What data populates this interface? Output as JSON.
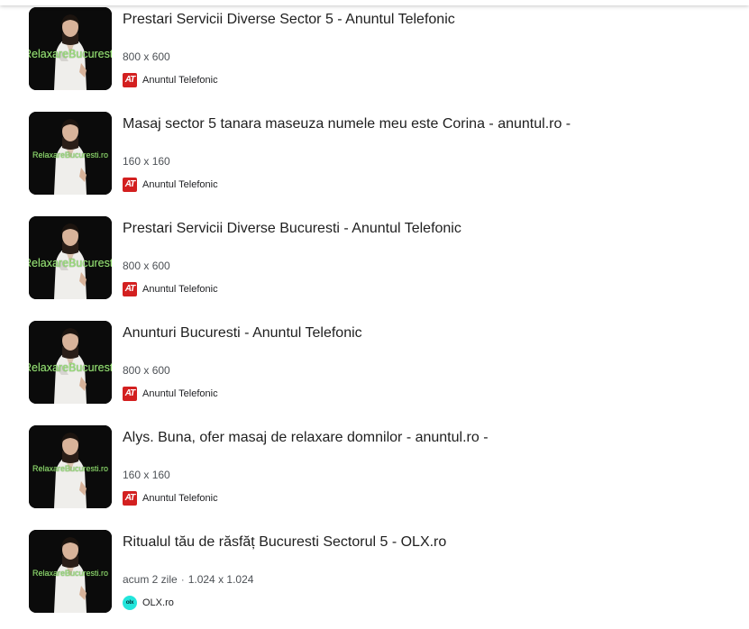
{
  "results": [
    {
      "title": "Prestari Servicii Diverse Sector 5 - Anuntul Telefonic",
      "meta": "800 x 600",
      "source": "Anuntul Telefonic",
      "favicon": "AT",
      "watermark": "RelaxareBucuresti.ro"
    },
    {
      "title": "Masaj sector 5 tanara maseuza numele meu este Corina - anuntul.ro -",
      "meta": "160 x 160",
      "source": "Anuntul Telefonic",
      "favicon": "AT",
      "watermark": "RelaxareBucuresti.ro"
    },
    {
      "title": "Prestari Servicii Diverse Bucuresti - Anuntul Telefonic",
      "meta": "800 x 600",
      "source": "Anuntul Telefonic",
      "favicon": "AT",
      "watermark": "RelaxareBucuresti.ro"
    },
    {
      "title": "Anunturi Bucuresti - Anuntul Telefonic",
      "meta": "800 x 600",
      "source": "Anuntul Telefonic",
      "favicon": "AT",
      "watermark": "RelaxareBucuresti.ro"
    },
    {
      "title": "Alys. Buna, ofer masaj de relaxare domnilor - anuntul.ro -",
      "meta": "160 x 160",
      "source": "Anuntul Telefonic",
      "favicon": "AT",
      "watermark": "RelaxareBucuresti.ro"
    },
    {
      "title": "Ritualul tău de răsfăț Bucuresti Sectorul 5 - OLX.ro",
      "meta_age": "acum 2 zile",
      "meta": "1.024 x 1.024",
      "source": "OLX.ro",
      "favicon": "olx",
      "watermark": "RelaxareBucuresti.ro"
    }
  ],
  "colors": {
    "at_favicon": "#d32020",
    "olx_favicon": "#23e5db",
    "watermark": "#9be07a",
    "thumb_background": "#0b0b0b"
  },
  "icons": [
    "anuntul-telefonic-favicon-icon",
    "olx-favicon-icon"
  ]
}
